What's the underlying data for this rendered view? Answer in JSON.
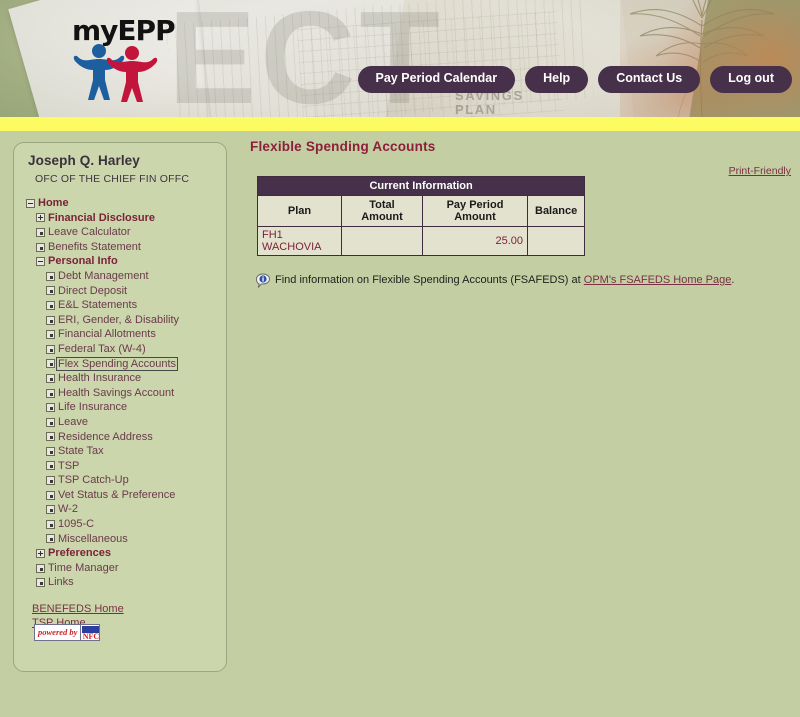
{
  "header": {
    "logo_text": "myEPP",
    "logo_icon": "two-people-logo",
    "ghost_text": "ECT",
    "savings_line1": "SAVINGS",
    "savings_line2": "PLAN",
    "nav_buttons": [
      {
        "label": "Pay Period Calendar",
        "name": "pay-period-calendar-button"
      },
      {
        "label": "Help",
        "name": "help-button"
      },
      {
        "label": "Contact Us",
        "name": "contact-us-button"
      },
      {
        "label": "Log out",
        "name": "log-out-button"
      }
    ]
  },
  "colors": {
    "band_purple": "#3f2d3f",
    "band_yellow": "#fdfb62",
    "page_bg": "#c3cfa2",
    "sidebar_bg": "#cbd6ad",
    "button_bg": "#46304a",
    "heading": "#8c1f3a",
    "link": "#7a3044",
    "table_header_bg": "#46304a",
    "table_cell_bg": "#e3e2cf"
  },
  "sidebar": {
    "user_name": "Joseph Q. Harley",
    "user_org": "OFC OF THE CHIEF FIN OFFC",
    "tree": [
      {
        "label": "Home",
        "level": 0,
        "toggle": "minus",
        "parent": true,
        "selected": false
      },
      {
        "label": "Financial Disclosure",
        "level": 1,
        "toggle": "plus",
        "parent": true,
        "selected": false
      },
      {
        "label": "Leave Calculator",
        "level": 1,
        "toggle": "dot",
        "parent": false,
        "selected": false
      },
      {
        "label": "Benefits Statement",
        "level": 1,
        "toggle": "dot",
        "parent": false,
        "selected": false
      },
      {
        "label": "Personal Info",
        "level": 1,
        "toggle": "minus",
        "parent": true,
        "selected": false
      },
      {
        "label": "Debt Management",
        "level": 2,
        "toggle": "dot",
        "parent": false,
        "selected": false
      },
      {
        "label": "Direct Deposit",
        "level": 2,
        "toggle": "dot",
        "parent": false,
        "selected": false
      },
      {
        "label": "E&L Statements",
        "level": 2,
        "toggle": "dot",
        "parent": false,
        "selected": false
      },
      {
        "label": "ERI, Gender, & Disability",
        "level": 2,
        "toggle": "dot",
        "parent": false,
        "selected": false
      },
      {
        "label": "Financial Allotments",
        "level": 2,
        "toggle": "dot",
        "parent": false,
        "selected": false
      },
      {
        "label": "Federal Tax (W-4)",
        "level": 2,
        "toggle": "dot",
        "parent": false,
        "selected": false
      },
      {
        "label": "Flex Spending Accounts",
        "level": 2,
        "toggle": "dot",
        "parent": false,
        "selected": true
      },
      {
        "label": "Health Insurance",
        "level": 2,
        "toggle": "dot",
        "parent": false,
        "selected": false
      },
      {
        "label": "Health Savings Account",
        "level": 2,
        "toggle": "dot",
        "parent": false,
        "selected": false
      },
      {
        "label": "Life Insurance",
        "level": 2,
        "toggle": "dot",
        "parent": false,
        "selected": false
      },
      {
        "label": "Leave",
        "level": 2,
        "toggle": "dot",
        "parent": false,
        "selected": false
      },
      {
        "label": "Residence Address",
        "level": 2,
        "toggle": "dot",
        "parent": false,
        "selected": false
      },
      {
        "label": "State Tax",
        "level": 2,
        "toggle": "dot",
        "parent": false,
        "selected": false
      },
      {
        "label": "TSP",
        "level": 2,
        "toggle": "dot",
        "parent": false,
        "selected": false
      },
      {
        "label": "TSP Catch-Up",
        "level": 2,
        "toggle": "dot",
        "parent": false,
        "selected": false
      },
      {
        "label": "Vet Status & Preference",
        "level": 2,
        "toggle": "dot",
        "parent": false,
        "selected": false
      },
      {
        "label": "W-2",
        "level": 2,
        "toggle": "dot",
        "parent": false,
        "selected": false
      },
      {
        "label": "1095-C",
        "level": 2,
        "toggle": "dot",
        "parent": false,
        "selected": false
      },
      {
        "label": "Miscellaneous",
        "level": 2,
        "toggle": "dot",
        "parent": false,
        "selected": false
      },
      {
        "label": "Preferences",
        "level": 1,
        "toggle": "plus",
        "parent": true,
        "selected": false
      },
      {
        "label": "Time Manager",
        "level": 1,
        "toggle": "dot",
        "parent": false,
        "selected": false
      },
      {
        "label": "Links",
        "level": 1,
        "toggle": "dot",
        "parent": false,
        "selected": false
      }
    ],
    "external_links": [
      {
        "label": "BENEFEDS Home",
        "name": "benefeds-home-link"
      },
      {
        "label": "TSP Home",
        "name": "tsp-home-link"
      }
    ],
    "powered_by": {
      "text": "powered by",
      "logo": "NFC"
    }
  },
  "main": {
    "page_title": "Flexible Spending Accounts",
    "print_friendly": "Print-Friendly",
    "table": {
      "caption": "Current Information",
      "columns": [
        "Plan",
        "Total Amount",
        "Pay Period Amount",
        "Balance"
      ],
      "rows": [
        {
          "plan": "FH1 WACHOVIA",
          "total_amount": "",
          "pay_period_amount": "25.00",
          "balance": ""
        }
      ]
    },
    "info": {
      "icon": "info-callout-icon",
      "text_before": "Find information on Flexible Spending Accounts (FSAFEDS) at ",
      "link_text": "OPM's FSAFEDS Home Page",
      "text_after": "."
    }
  }
}
